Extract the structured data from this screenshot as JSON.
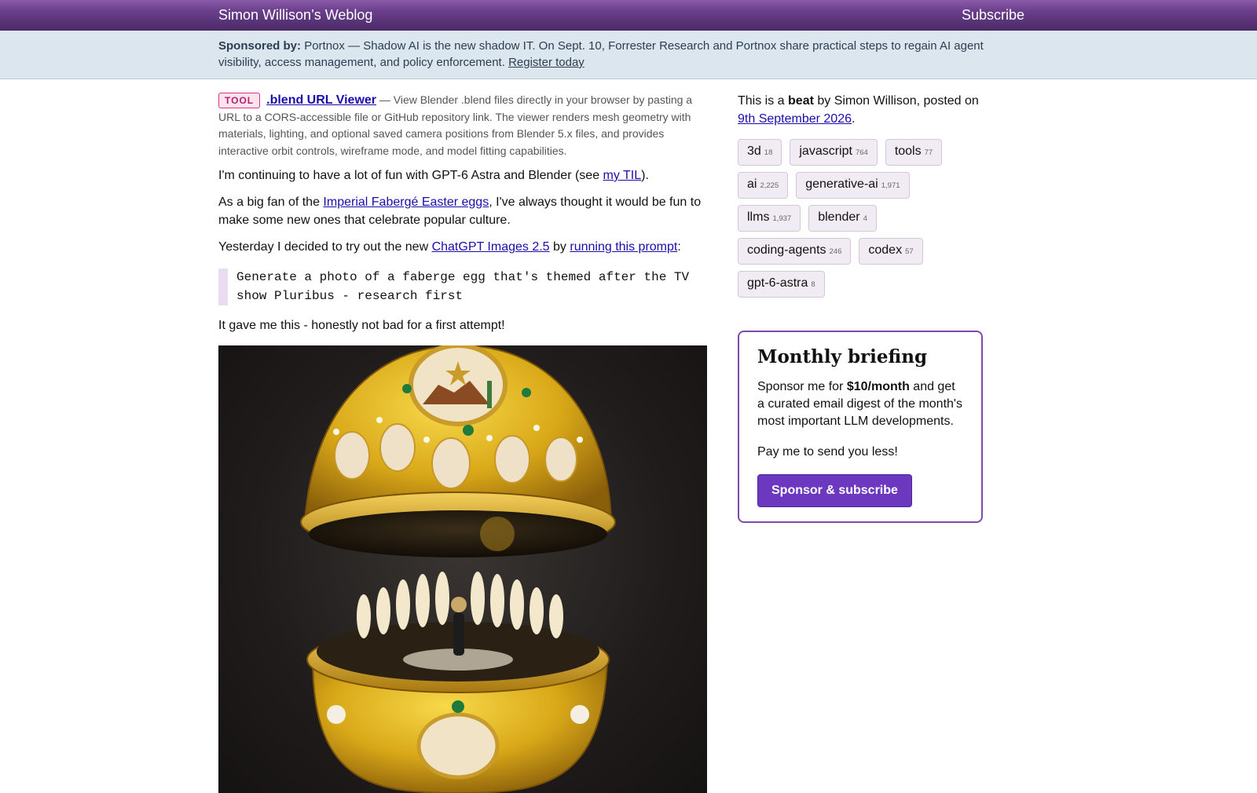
{
  "header": {
    "site_title": "Simon Willison’s Weblog",
    "subscribe_label": "Subscribe"
  },
  "sponsor": {
    "label": "Sponsored by:",
    "text": "Portnox — Shadow AI is the new shadow IT. On Sept. 10, Forrester Research and Portnox share practical steps to regain AI agent visibility, access management, and policy enforcement.",
    "link_text": "Register today"
  },
  "article": {
    "tool_badge": "TOOL",
    "tool_name": ".blend URL Viewer",
    "tool_description": "— View Blender .blend files directly in your browser by pasting a URL to a CORS-accessible file or GitHub repository link. The viewer renders mesh geometry with materials, lighting, and optional saved camera positions from Blender 5.x files, and provides interactive orbit controls, wireframe mode, and model fitting capabilities.",
    "p1_before": "I'm continuing to have a lot of fun with GPT-6 Astra and Blender (see ",
    "p1_link": "my TIL",
    "p1_after": ").",
    "p2_before": "As a big fan of the ",
    "p2_link": "Imperial Fabergé Easter eggs",
    "p2_after": ", I've always thought it would be fun to make some new ones that celebrate popular culture.",
    "p3_before": "Yesterday I decided to try out the new ",
    "p3_link1": "ChatGPT Images 2.5",
    "p3_mid": " by ",
    "p3_link2": "running this prompt",
    "p3_after": ":",
    "prompt_line1": "Generate a photo of a faberge egg that's themed after the TV",
    "prompt_line2": "show Pluribus - research first",
    "p4": "It gave me this - honestly not bad for a first attempt!"
  },
  "sidebar": {
    "beat_prefix": "This is a ",
    "beat_word": "beat",
    "beat_middle": " by Simon Willison, posted on ",
    "beat_date": "9th September 2026",
    "beat_end": ".",
    "tags": [
      {
        "name": "3d",
        "count": "18"
      },
      {
        "name": "javascript",
        "count": "764"
      },
      {
        "name": "tools",
        "count": "77"
      },
      {
        "name": "ai",
        "count": "2,225"
      },
      {
        "name": "generative-ai",
        "count": "1,971"
      },
      {
        "name": "llms",
        "count": "1,937"
      },
      {
        "name": "blender",
        "count": "4"
      },
      {
        "name": "coding-agents",
        "count": "246"
      },
      {
        "name": "codex",
        "count": "57"
      },
      {
        "name": "gpt-6-astra",
        "count": "8"
      }
    ],
    "briefing": {
      "title": "Monthly briefing",
      "text_before": "Sponsor me for ",
      "text_bold": "$10/month",
      "text_after": " and get a curated email digest of the month's most important LLM developments.",
      "tagline": "Pay me to send you less!",
      "button_label": "Sponsor & subscribe"
    }
  },
  "colors": {
    "header_purple": "#5b3478",
    "sponsor_bg": "#dbe6ef",
    "tag_bg": "#f1ebf3",
    "button_purple": "#6d38c0"
  }
}
